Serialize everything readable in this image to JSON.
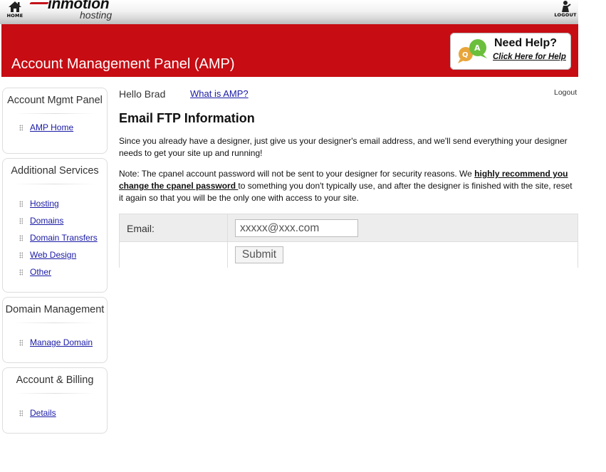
{
  "header": {
    "home_label": "HOME",
    "logo_brand": "inmotion",
    "logo_sub": "hosting",
    "logout_label": "LOGOUT"
  },
  "banner": {
    "title": "Account Management Panel (AMP)",
    "help_title": "Need Help?",
    "help_link": "Click Here for Help"
  },
  "sidebar": {
    "sections": [
      {
        "title": "Account Mgmt Panel",
        "items": [
          "AMP Home"
        ]
      },
      {
        "title": "Additional Services",
        "items": [
          "Hosting",
          "Domains",
          "Domain Transfers",
          "Web Design",
          "Other"
        ]
      },
      {
        "title": "Domain Management",
        "items": [
          "Manage Domain"
        ]
      },
      {
        "title": "Account & Billing",
        "items": [
          "Details"
        ]
      }
    ]
  },
  "main": {
    "greeting": "Hello Brad",
    "what_is_link": "What is AMP?",
    "logout_link": "Logout",
    "heading": "Email FTP Information",
    "paragraph1": "Since you already have a designer, just give us your designer's email address, and we'll send everything your designer needs to get your site up and running!",
    "paragraph2_before": "Note: The cpanel account password will not be sent to your designer for security reasons. We ",
    "paragraph2_bold": "highly recommend you change the cpanel password ",
    "paragraph2_after": "to something you don't typically use, and after the designer is finished with the site, reset it again so that you will be the only one with access to your site.",
    "form": {
      "email_label": "Email:",
      "email_value": "xxxxx@xxx.com",
      "submit_label": "Submit"
    }
  },
  "colors": {
    "banner_red": "#c70c13",
    "link_blue": "#1a1aa6"
  }
}
